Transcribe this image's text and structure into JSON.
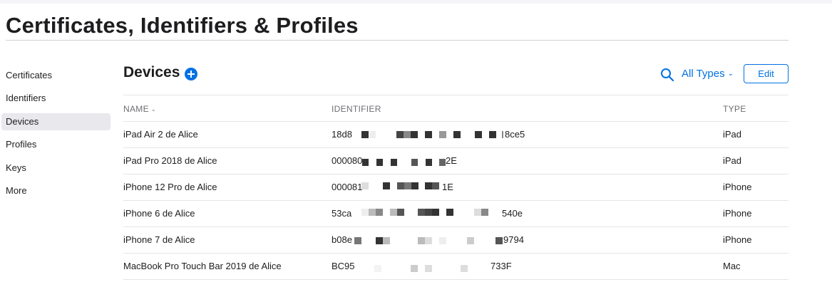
{
  "page": {
    "title": "Certificates, Identifiers & Profiles"
  },
  "sidebar": {
    "items": [
      {
        "label": "Certificates",
        "active": false
      },
      {
        "label": "Identifiers",
        "active": false
      },
      {
        "label": "Devices",
        "active": true
      },
      {
        "label": "Profiles",
        "active": false
      },
      {
        "label": "Keys",
        "active": false
      },
      {
        "label": "More",
        "active": false
      }
    ]
  },
  "main": {
    "title": "Devices",
    "add_icon": "plus-circle-icon",
    "search_icon": "search-icon",
    "type_filter": "All Types",
    "edit_label": "Edit",
    "accent_color": "#0071e3"
  },
  "table": {
    "columns": {
      "name": "NAME",
      "identifier": "IDENTIFIER",
      "type": "TYPE"
    },
    "rows": [
      {
        "name": "iPad Air 2 de Alice",
        "id_start": "18d8",
        "id_end": "8ce5",
        "type": "iPad"
      },
      {
        "name": "iPad Pro 2018 de Alice",
        "id_start": "000080",
        "id_end": "2E",
        "type": "iPad"
      },
      {
        "name": "iPhone 12 Pro de Alice",
        "id_start": "000081",
        "id_end": "1E",
        "type": "iPhone"
      },
      {
        "name": "iPhone 6 de Alice",
        "id_start": "53ca",
        "id_end": "540e",
        "type": "iPhone"
      },
      {
        "name": "iPhone 7 de Alice",
        "id_start": "b08e",
        "id_end": "9794",
        "type": "iPhone"
      },
      {
        "name": "MacBook Pro Touch Bar 2019 de Alice",
        "id_start": "BC95",
        "id_end": "733F",
        "type": "Mac"
      }
    ]
  }
}
